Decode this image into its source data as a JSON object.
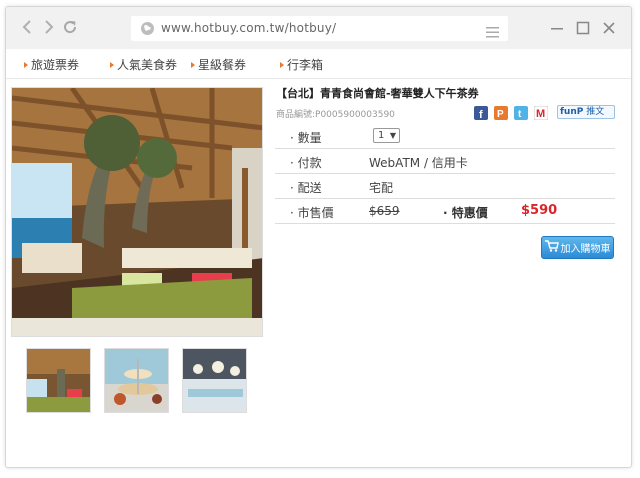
{
  "browser": {
    "url": "www.hotbuy.com.tw/hotbuy/"
  },
  "nav": {
    "items": [
      "旅遊票券",
      "人氣美食券",
      "星級餐券",
      "行李箱"
    ]
  },
  "product": {
    "title": "【台北】青青食尚會館-奢華雙人下午茶券",
    "code": "商品編號:P0005900003590",
    "share_funp": "funP",
    "share_funp_sub": "推文",
    "rows": {
      "qty_label": "數量",
      "qty_value": "1",
      "pay_label": "付款",
      "pay_value": "WebATM / 信用卡",
      "ship_label": "配送",
      "ship_value": "宅配",
      "list_label": "市售價",
      "list_value": "$659",
      "special_label": "特惠價",
      "special_value": "$590"
    },
    "cart_button": "加入購物車"
  },
  "colors": {
    "accent_orange": "#e8792e",
    "price_red": "#d9262c",
    "button_blue": "#2a8bd6"
  }
}
